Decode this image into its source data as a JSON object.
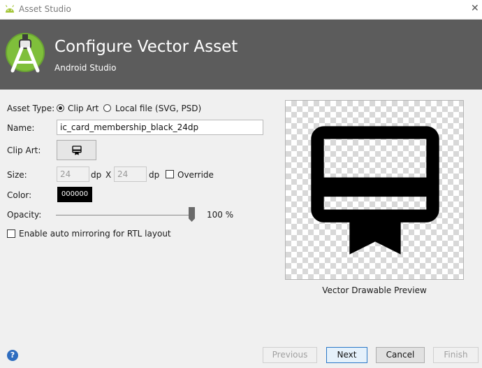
{
  "window": {
    "title": "Asset Studio",
    "close_glyph": "✕"
  },
  "header": {
    "title": "Configure Vector Asset",
    "subtitle": "Android Studio"
  },
  "form": {
    "asset_type_label": "Asset Type:",
    "asset_type_options": [
      "Clip Art",
      "Local file (SVG, PSD)"
    ],
    "asset_type_selected": "Clip Art",
    "name_label": "Name:",
    "name_value": "ic_card_membership_black_24dp",
    "clip_art_label": "Clip Art:",
    "clip_art_icon": "card-membership-icon",
    "size_label": "Size:",
    "size_width": "24",
    "size_width_unit": "dp",
    "size_separator": "X",
    "size_height": "24",
    "size_height_unit": "dp",
    "override_label": "Override",
    "override_checked": false,
    "color_label": "Color:",
    "color_value": "000000",
    "opacity_label": "Opacity:",
    "opacity_value": 100,
    "opacity_text": "100 %",
    "rtl_label": "Enable auto mirroring for RTL layout",
    "rtl_checked": false
  },
  "preview": {
    "caption": "Vector Drawable Preview",
    "icon": "card-membership-icon"
  },
  "footer": {
    "help_glyph": "?",
    "previous_label": "Previous",
    "next_label": "Next",
    "cancel_label": "Cancel",
    "finish_label": "Finish"
  },
  "colors": {
    "header_bg": "#5c5c5c",
    "android_green": "#a4c639",
    "help_blue": "#2f6dbf"
  }
}
